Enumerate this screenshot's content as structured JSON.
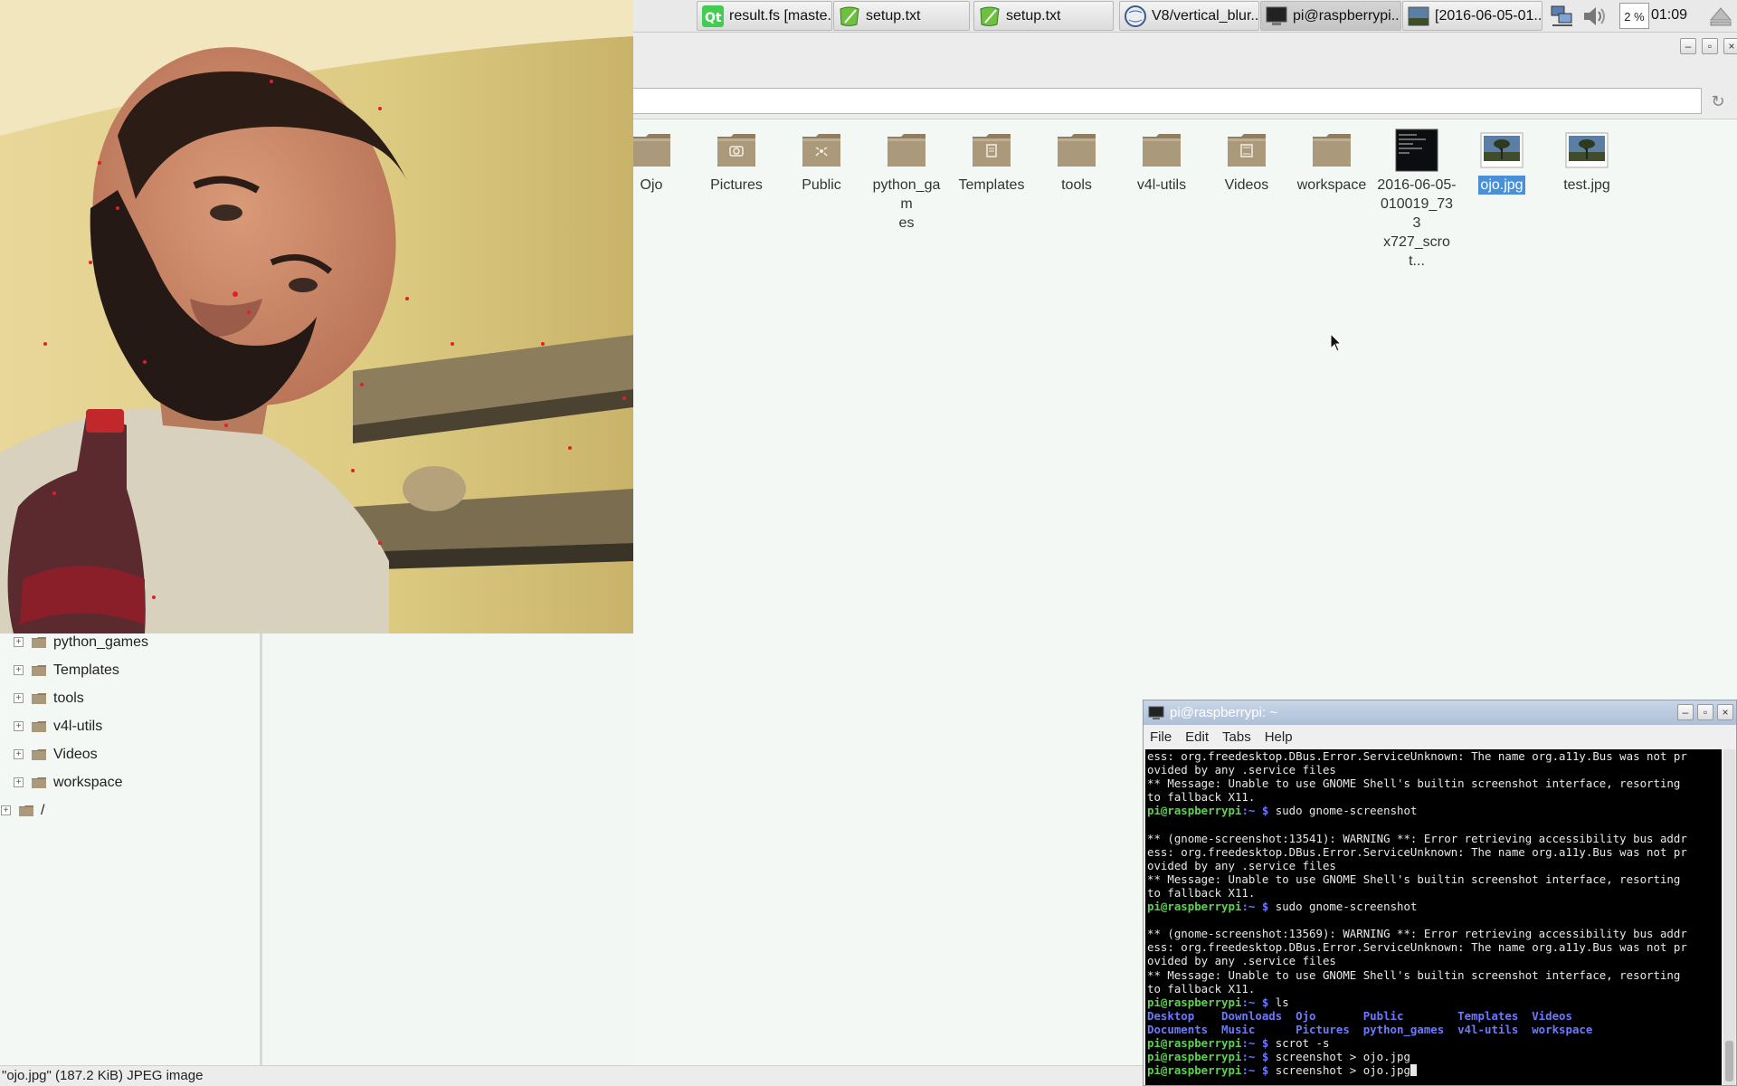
{
  "taskbar": {
    "buttons": [
      {
        "label": "result.fs [maste...",
        "icon": "qt-creator-icon"
      },
      {
        "label": "setup.txt",
        "icon": "text-editor-icon"
      },
      {
        "label": "setup.txt",
        "icon": "text-editor-icon"
      },
      {
        "label": "V8/vertical_blur...",
        "icon": "browser-icon"
      },
      {
        "label": "pi@raspberrypi...",
        "icon": "terminal-icon"
      },
      {
        "label": "[2016-06-05-01...",
        "icon": "image-viewer-icon"
      }
    ],
    "cpu": "2 %",
    "clock": "01:09"
  },
  "file_manager": {
    "items": [
      {
        "label": "Ojo",
        "type": "folder"
      },
      {
        "label": "Pictures",
        "type": "folder-pictures"
      },
      {
        "label": "Public",
        "type": "folder-public"
      },
      {
        "label": "python_gam\nes",
        "type": "folder"
      },
      {
        "label": "Templates",
        "type": "folder-templates"
      },
      {
        "label": "tools",
        "type": "folder"
      },
      {
        "label": "v4l-utils",
        "type": "folder"
      },
      {
        "label": "Videos",
        "type": "folder-videos"
      },
      {
        "label": "workspace",
        "type": "folder"
      },
      {
        "label": "2016-06-05-\n010019_733\nx727_scrot...",
        "type": "screenshot"
      },
      {
        "label": "ojo.jpg",
        "type": "image",
        "selected": true
      },
      {
        "label": "test.jpg",
        "type": "image"
      }
    ],
    "tree": [
      {
        "label": "python_games"
      },
      {
        "label": "Templates"
      },
      {
        "label": "tools"
      },
      {
        "label": "v4l-utils"
      },
      {
        "label": "Videos"
      },
      {
        "label": "workspace"
      },
      {
        "label": "/"
      }
    ],
    "status": "\"ojo.jpg\" (187.2 KiB) JPEG image"
  },
  "terminal": {
    "title": "pi@raspberrypi: ~",
    "menu": [
      "File",
      "Edit",
      "Tabs",
      "Help"
    ],
    "prompt_user": "pi@raspberrypi",
    "prompt_path": ":~ $ ",
    "lines": [
      {
        "t": "out",
        "text": "ess: org.freedesktop.DBus.Error.ServiceUnknown: The name org.a11y.Bus was not pr"
      },
      {
        "t": "out",
        "text": "ovided by any .service files"
      },
      {
        "t": "out",
        "text": "** Message: Unable to use GNOME Shell's builtin screenshot interface, resorting"
      },
      {
        "t": "out",
        "text": "to fallback X11."
      },
      {
        "t": "cmd",
        "text": "sudo gnome-screenshot"
      },
      {
        "t": "out",
        "text": ""
      },
      {
        "t": "out",
        "text": "** (gnome-screenshot:13541): WARNING **: Error retrieving accessibility bus addr"
      },
      {
        "t": "out",
        "text": "ess: org.freedesktop.DBus.Error.ServiceUnknown: The name org.a11y.Bus was not pr"
      },
      {
        "t": "out",
        "text": "ovided by any .service files"
      },
      {
        "t": "out",
        "text": "** Message: Unable to use GNOME Shell's builtin screenshot interface, resorting"
      },
      {
        "t": "out",
        "text": "to fallback X11."
      },
      {
        "t": "cmd",
        "text": "sudo gnome-screenshot"
      },
      {
        "t": "out",
        "text": ""
      },
      {
        "t": "out",
        "text": "** (gnome-screenshot:13569): WARNING **: Error retrieving accessibility bus addr"
      },
      {
        "t": "out",
        "text": "ess: org.freedesktop.DBus.Error.ServiceUnknown: The name org.a11y.Bus was not pr"
      },
      {
        "t": "out",
        "text": "ovided by any .service files"
      },
      {
        "t": "out",
        "text": "** Message: Unable to use GNOME Shell's builtin screenshot interface, resorting"
      },
      {
        "t": "out",
        "text": "to fallback X11."
      },
      {
        "t": "cmd",
        "text": "ls"
      },
      {
        "t": "dirs",
        "text": "Desktop    Downloads  Ojo       Public        Templates  Videos"
      },
      {
        "t": "dirs",
        "text": "Documents  Music      Pictures  python_games  v4l-utils  workspace"
      },
      {
        "t": "cmd",
        "text": "scrot -s"
      },
      {
        "t": "cmd",
        "text": "screenshot > ojo.jpg"
      },
      {
        "t": "cmd",
        "text": "screenshot > ojo.jpg",
        "cursor": true
      }
    ]
  },
  "colors": {
    "selection": "#4a90d9",
    "prompt_green": "#5bd34e",
    "dir_blue": "#6c79ff",
    "folder_brown": "#a89678"
  }
}
